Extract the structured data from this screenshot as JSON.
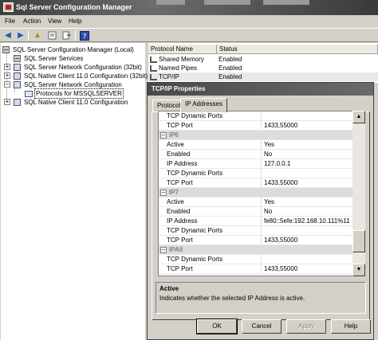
{
  "window": {
    "title": "Sql Server Configuration Manager"
  },
  "menu": [
    "File",
    "Action",
    "View",
    "Help"
  ],
  "toolbar": {
    "icons": [
      "back-icon",
      "forward-icon",
      "up-folder-icon",
      "properties-icon",
      "export-icon",
      "help-icon"
    ]
  },
  "tree": {
    "items": [
      {
        "label": "SQL Server Configuration Manager (Local)",
        "icon": "server-icon"
      },
      {
        "label": "SQL Server Services",
        "icon": "services-icon"
      },
      {
        "label": "SQL Server Network Configuration (32bit)",
        "icon": "network-icon"
      },
      {
        "label": "SQL Native Client 11.0 Configuration (32bit)",
        "icon": "client-icon"
      },
      {
        "label": "SQL Server Network Configuration",
        "icon": "network-icon"
      },
      {
        "label": "Protocols for MSSQLSERVER",
        "icon": "protocols-icon"
      },
      {
        "label": "SQL Native Client 11.0 Configuration",
        "icon": "client-icon"
      }
    ]
  },
  "list": {
    "headers": [
      "Protocol Name",
      "Status"
    ],
    "rows": [
      {
        "name": "Shared Memory",
        "status": "Enabled"
      },
      {
        "name": "Named Pipes",
        "status": "Enabled"
      },
      {
        "name": "TCP/IP",
        "status": "Enabled"
      }
    ]
  },
  "dialog": {
    "title": "TCP/IP Properties",
    "tabs": [
      "Protocol",
      "IP Addresses"
    ],
    "grid": [
      {
        "key": "TCP Dynamic Ports",
        "value": ""
      },
      {
        "key": "TCP Port",
        "value": "1433,55000"
      },
      {
        "key": "IP6",
        "value": "",
        "category": true
      },
      {
        "key": "Active",
        "value": "Yes"
      },
      {
        "key": "Enabled",
        "value": "No"
      },
      {
        "key": "IP Address",
        "value": "127.0.0.1"
      },
      {
        "key": "TCP Dynamic Ports",
        "value": ""
      },
      {
        "key": "TCP Port",
        "value": "1433,55000"
      },
      {
        "key": "IP7",
        "value": "",
        "category": true
      },
      {
        "key": "Active",
        "value": "Yes"
      },
      {
        "key": "Enabled",
        "value": "No"
      },
      {
        "key": "IP Address",
        "value": "fe80::5efe:192.168.10.111%11"
      },
      {
        "key": "TCP Dynamic Ports",
        "value": ""
      },
      {
        "key": "TCP Port",
        "value": "1433,55000"
      },
      {
        "key": "IPAll",
        "value": "",
        "category": true
      },
      {
        "key": "TCP Dynamic Ports",
        "value": ""
      },
      {
        "key": "TCP Port",
        "value": "1433,55000"
      }
    ],
    "description": {
      "title": "Active",
      "text": "Indicates whether the selected IP Address is active."
    },
    "buttons": {
      "ok": "OK",
      "cancel": "Cancel",
      "apply": "Apply",
      "help": "Help"
    }
  }
}
